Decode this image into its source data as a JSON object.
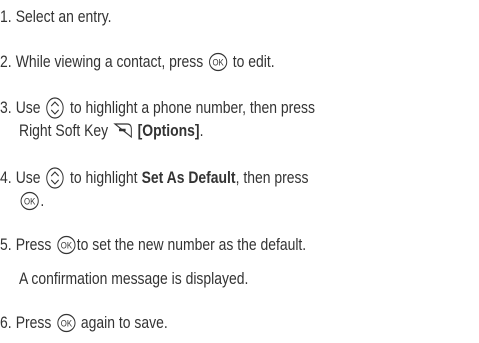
{
  "steps": [
    {
      "num": "1.",
      "text": "Select an entry."
    },
    {
      "num": "2.",
      "pre": "While viewing a contact, press",
      "post": "to edit.",
      "icon": "ok-icon"
    },
    {
      "num": "3.",
      "pre": "Use",
      "post": "to highlight a phone number, then press",
      "icon": "nav-updown-icon",
      "cont_pre": "Right Soft Key",
      "cont_bold": "[Options]",
      "cont_post": ".",
      "cont_icon": "right-softkey-icon"
    },
    {
      "num": "4.",
      "pre": "Use",
      "mid": "to highlight",
      "bold": "Set As Default",
      "post": ", then press",
      "icon": "nav-updown-icon",
      "cont_icon": "ok-icon",
      "cont_post": "."
    },
    {
      "num": "5.",
      "pre": "Press",
      "post": "to set the new number as the default.",
      "icon": "ok-icon",
      "cont_text": "A confirmation message is displayed."
    },
    {
      "num": "6.",
      "pre": "Press",
      "post": "again to save.",
      "icon": "ok-icon"
    }
  ],
  "icon_glyph": {
    "ok": "OK"
  },
  "colors": {
    "text": "#333333",
    "icon_stroke": "#333333"
  }
}
